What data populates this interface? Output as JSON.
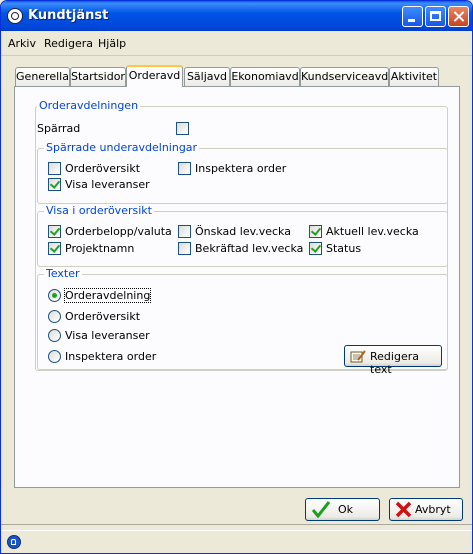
{
  "window": {
    "title": "Kundtjänst"
  },
  "menu": {
    "items": [
      "Arkiv",
      "Redigera",
      "Hjälp"
    ]
  },
  "tabs": [
    "Generella",
    "Startsidor",
    "Orderavd",
    "Säljavd",
    "Ekonomiavd",
    "Kundserviceavd",
    "Aktivitet"
  ],
  "active_tab": "Orderavd",
  "orderavdelningen": {
    "title": "Orderavdelningen",
    "sparrad_label": "Spärrad",
    "sparrad_checked": false
  },
  "sparrade": {
    "title": "Spärrade underavdelningar",
    "orderoversikt": {
      "label": "Orderöversikt",
      "checked": false
    },
    "inspektera": {
      "label": "Inspektera order",
      "checked": false
    },
    "visa_leveranser": {
      "label": "Visa leveranser",
      "checked": true
    }
  },
  "visa": {
    "title": "Visa i orderöversikt",
    "orderbelopp": {
      "label": "Orderbelopp/valuta",
      "checked": true
    },
    "onskad": {
      "label": "Önskad lev.vecka",
      "checked": false
    },
    "aktuell": {
      "label": "Aktuell lev.vecka",
      "checked": true
    },
    "projektnamn": {
      "label": "Projektnamn",
      "checked": true
    },
    "bekraftad": {
      "label": "Bekräftad lev.vecka",
      "checked": false
    },
    "status": {
      "label": "Status",
      "checked": true
    }
  },
  "texter": {
    "title": "Texter",
    "options": [
      "Orderavdelning",
      "Orderöversikt",
      "Visa leveranser",
      "Inspektera order"
    ],
    "selected": "Orderavdelning",
    "edit_button": "Redigera text"
  },
  "buttons": {
    "ok": "Ok",
    "cancel": "Avbryt"
  },
  "colors": {
    "titlebar": "#0055e5",
    "group_title": "#0046d5",
    "check": "#21a121",
    "tab_highlight": "#ffc83c"
  }
}
